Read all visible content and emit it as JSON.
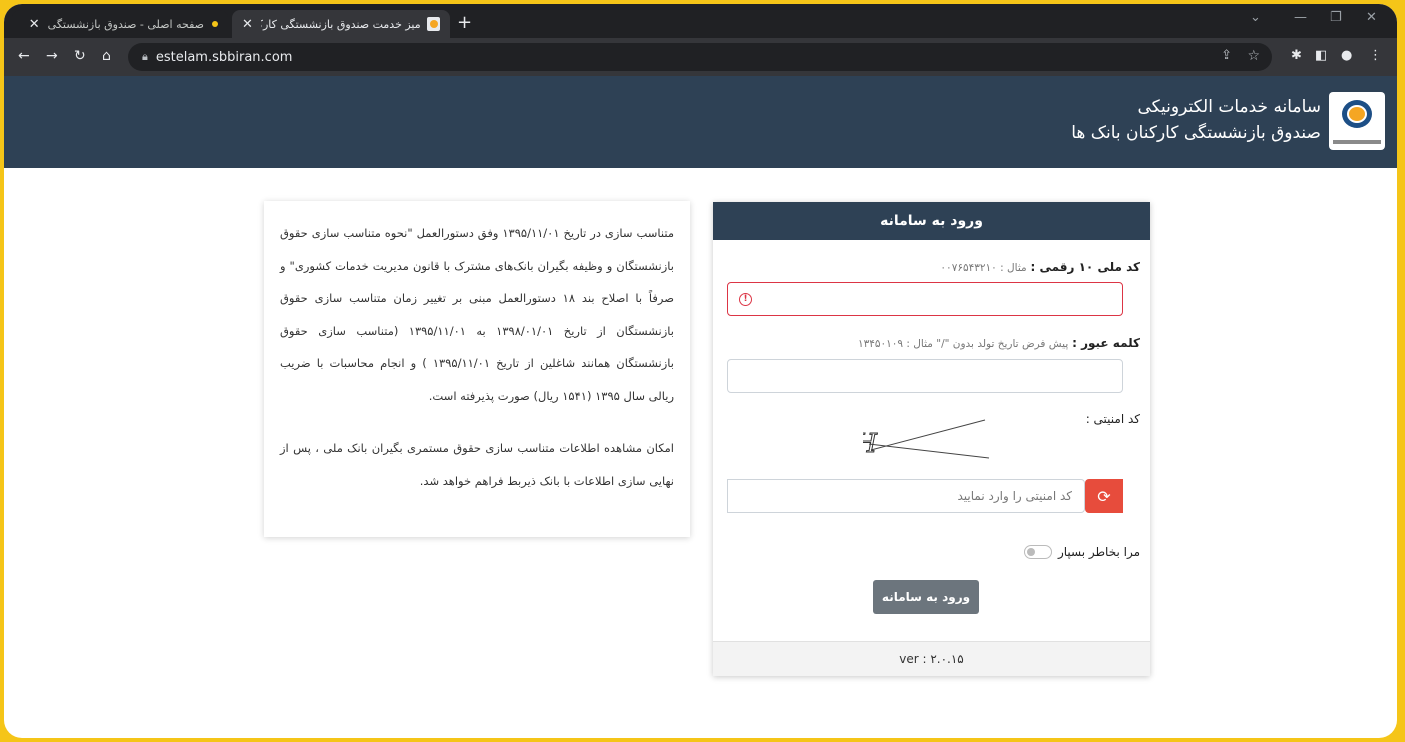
{
  "browser": {
    "tabs": [
      {
        "title": "صفحه اصلی - صندوق بازنشستگی",
        "active": false
      },
      {
        "title": "میز خدمت صندوق بازنشستگی کارک",
        "active": true
      }
    ],
    "new_tab": "+",
    "url": "estelam.sbbiran.com"
  },
  "site": {
    "title_line1": "سامانه خدمات الکترونیکی",
    "title_line2": "صندوق بازنشستگی کارکنان بانک ها"
  },
  "info": {
    "paragraph1": "متناسب سازی در تاریخ ۱۳۹۵/۱۱/۰۱ وفق دستورالعمل \"نحوه متناسب سازی حقوق بازنشستگان و وظیفه بگیران بانک‌های مشترک با قانون مدیریت خدمات کشوری\" و صرفاً با اصلاح بند ۱۸ دستورالعمل مبنی بر تغییر زمان متناسب سازی حقوق بازنشستگان از تاریخ ۱۳۹۸/۰۱/۰۱ به ۱۳۹۵/۱۱/۰۱ (متناسب سازی حقوق بازنشستگان همانند شاغلین از تاریخ ۱۳۹۵/۱۱/۰۱ ) و انجام محاسبات با ضریب ریالی سال ۱۳۹۵ (۱۵۴۱ ریال) صورت پذیرفته است.",
    "paragraph2": "امکان مشاهده اطلاعات متناسب سازی حقوق مستمری بگیران بانک ملی ، پس از نهایی سازی اطلاعات با بانک ذیربط فراهم خواهد شد."
  },
  "login": {
    "header": "ورود به سامانه",
    "national_code_label": "کد ملی ۱۰ رقمی :",
    "national_code_hint": "مثال : ۰۰۷۶۵۴۳۲۱۰",
    "password_label": "کلمه عبور :",
    "password_hint": "پیش فرض تاریخ تولد بدون \"/\" مثال : ۱۳۴۵۰۱۰۹",
    "captcha_label": "کد امنیتی :",
    "captcha_text": "rQGH",
    "captcha_placeholder": "کد امنیتی را وارد نمایید",
    "remember_label": "مرا بخاطر بسپار",
    "submit_label": "ورود به سامانه",
    "version": "ver : ۲.۰.۱۵"
  },
  "colors": {
    "header_bg": "#2e4155",
    "error": "#dc3545",
    "refresh": "#e74c3c",
    "submit": "#6c757d"
  }
}
